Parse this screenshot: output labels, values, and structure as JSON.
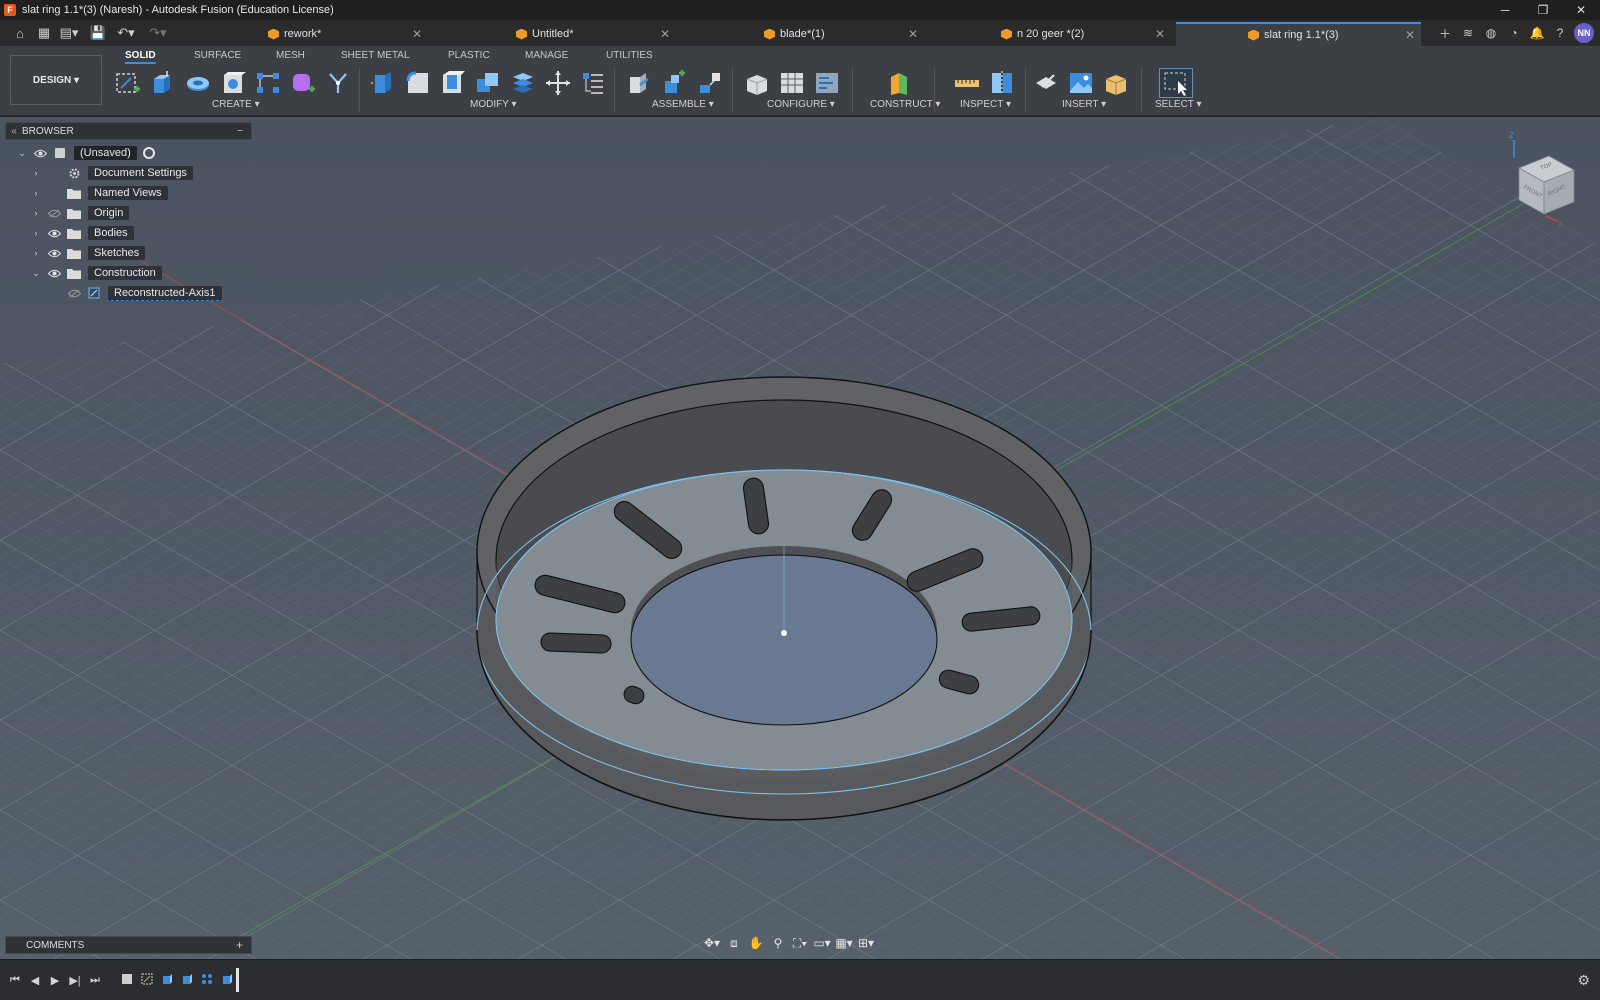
{
  "window": {
    "title": "slat ring 1.1*(3) (Naresh) - Autodesk Fusion (Education License)",
    "logo_letter": "F"
  },
  "tabs": [
    {
      "label": "rework*",
      "active": false
    },
    {
      "label": "Untitled*",
      "active": false
    },
    {
      "label": "blade*(1)",
      "active": false
    },
    {
      "label": "n 20 geer *(2)",
      "active": false
    },
    {
      "label": "slat ring 1.1*(3)",
      "active": true
    }
  ],
  "user": {
    "initials": "NN"
  },
  "workspace": {
    "label": "DESIGN"
  },
  "ribbon_tabs": [
    "SOLID",
    "SURFACE",
    "MESH",
    "SHEET METAL",
    "PLASTIC",
    "MANAGE",
    "UTILITIES"
  ],
  "ribbon_groups": {
    "create": "CREATE",
    "modify": "MODIFY",
    "assemble": "ASSEMBLE",
    "configure": "CONFIGURE",
    "construct": "CONSTRUCT",
    "inspect": "INSPECT",
    "insert": "INSERT",
    "select": "SELECT"
  },
  "browser": {
    "title": "BROWSER",
    "root": "(Unsaved)",
    "items": [
      {
        "label": "Document Settings",
        "icon": "gear-icon"
      },
      {
        "label": "Named Views",
        "icon": "folder-icon"
      },
      {
        "label": "Origin",
        "icon": "folder-icon"
      },
      {
        "label": "Bodies",
        "icon": "folder-icon"
      },
      {
        "label": "Sketches",
        "icon": "folder-icon"
      },
      {
        "label": "Construction",
        "icon": "folder-icon"
      },
      {
        "label": "Reconstructed-Axis1",
        "icon": "axis-icon"
      }
    ]
  },
  "comments": {
    "title": "COMMENTS"
  },
  "viewcube": {
    "top": "TOP",
    "front": "FRONT",
    "right": "RIGHT",
    "axis_z": "Z",
    "axis_x": "X"
  },
  "colors": {
    "accent": "#3c8dde",
    "viewport_bg": "#4d5662",
    "body": "#5c5e61",
    "tab_cube": "#f09a2a",
    "avatar": "#6a5fc7"
  }
}
